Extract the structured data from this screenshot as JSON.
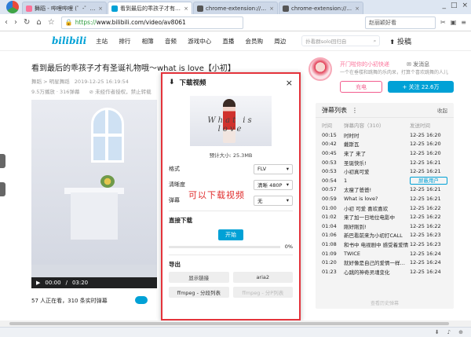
{
  "browser": {
    "tabs": [
      {
        "title": "舞蹈 - 哔哩哔哩 (゜-゜)つロ 干杯",
        "favicon_color": "#fb7299"
      },
      {
        "title": "看到最后的乖孩子才有圣诞礼",
        "favicon_color": "#00a1d6"
      },
      {
        "title": "chrome-extension://dhdj",
        "favicon_color": "#555555"
      },
      {
        "title": "chrome-extension://dhdj",
        "favicon_color": "#555555"
      }
    ],
    "url_scheme": "https://",
    "url_rest": "www.bilibili.com/video/av8061",
    "user": "赵丽颖好看",
    "window_controls": [
      "_",
      "□",
      "×"
    ]
  },
  "site": {
    "logo": "bilibili",
    "nav": [
      "主站",
      "排行",
      "相簿",
      "音频",
      "游戏中心",
      "直播",
      "会员购",
      "周边"
    ],
    "search_placeholder": "扑看群solo回归自",
    "upload": "投稿"
  },
  "video": {
    "title": "看到最后的乖孩子才有圣诞礼物哦～what is love【小初】",
    "category": "舞蹈 > 明星舞蹈",
    "date": "2019-12-25 16:19:54",
    "stats": "9.5万播放 · 316弹幕",
    "warning": "未经作者授权，禁止转载",
    "time_current": "00:00",
    "time_total": "03:20",
    "viewers": "57 人正在看，310 条实时弹幕"
  },
  "up": {
    "name": "开门啦你的小初快递",
    "message": "发消息",
    "desc": "一个在垂楼和跳舞的乐肉呆，打算个喜欢跳舞的人儿",
    "charge": "充电",
    "follow": "+ 关注 22.6万"
  },
  "danmaku": {
    "title": "弹幕列表",
    "collapse": "收起",
    "cols": [
      "时间",
      "弹幕内容（310）",
      "发送时间"
    ],
    "rows": [
      {
        "t": "00:15",
        "c": "时时时",
        "d": "12-25 16:20"
      },
      {
        "t": "00:42",
        "c": "戴斯瓦",
        "d": "12-25 16:20"
      },
      {
        "t": "00:45",
        "c": "来了 来了",
        "d": "12-25 16:20"
      },
      {
        "t": "00:53",
        "c": "圣诞快乐!",
        "d": "12-25 16:21"
      },
      {
        "t": "00:53",
        "c": "小初真可爱",
        "d": "12-25 16:21"
      },
      {
        "t": "00:54",
        "c": "1",
        "d": "屏蔽用户",
        "hl": true
      },
      {
        "t": "00:57",
        "c": "太瘦了爸爸!",
        "d": "12-25 16:21"
      },
      {
        "t": "00:59",
        "c": "What is love?",
        "d": "12-25 16:21"
      },
      {
        "t": "01:00",
        "c": "小初 可爱 喜欢喜欢",
        "d": "12-25 16:22"
      },
      {
        "t": "01:02",
        "c": "来了加一日地位电影中",
        "d": "12-25 16:22"
      },
      {
        "t": "01:04",
        "c": "刚好刚到!",
        "d": "12-25 16:22"
      },
      {
        "t": "01:06",
        "c": "新巴看前来为小初打CALL",
        "d": "12-25 16:23"
      },
      {
        "t": "01:08",
        "c": "和书中 电视剧中 感受着爱情",
        "d": "12-25 16:23"
      },
      {
        "t": "01:09",
        "c": "TWICE",
        "d": "12-25 16:24"
      },
      {
        "t": "01:20",
        "c": "就好像是自己的爱情一样理动",
        "d": "12-25 16:24"
      },
      {
        "t": "01:23",
        "c": "心跳的神奇灵魂变化",
        "d": "12-25 16:24"
      }
    ],
    "footer": "查看历史弹幕"
  },
  "dialog": {
    "title": "下载视频",
    "thumb_text": "What is love",
    "estimate": "预计大小: 25.3MB",
    "format_label": "格式",
    "format_value": "FLV",
    "quality_label": "清晰度",
    "quality_value": "清晰 480P",
    "danmaku_label": "弹幕",
    "danmaku_value": "无",
    "direct_label": "直接下载",
    "start": "开始",
    "progress": "0%",
    "progress_fraction": 0,
    "export_label": "导出",
    "export_buttons": [
      {
        "label": "显示链接",
        "disabled": false
      },
      {
        "label": "aria2",
        "disabled": false
      },
      {
        "label": "ffmpeg - 分段列表",
        "disabled": false
      },
      {
        "label": "ffmpeg - 分P列表",
        "disabled": true
      }
    ]
  },
  "annotation": "可以下载视频",
  "colors": {
    "accent": "#00a1d6",
    "pink": "#fb7299",
    "highlight": "#e4333b"
  }
}
